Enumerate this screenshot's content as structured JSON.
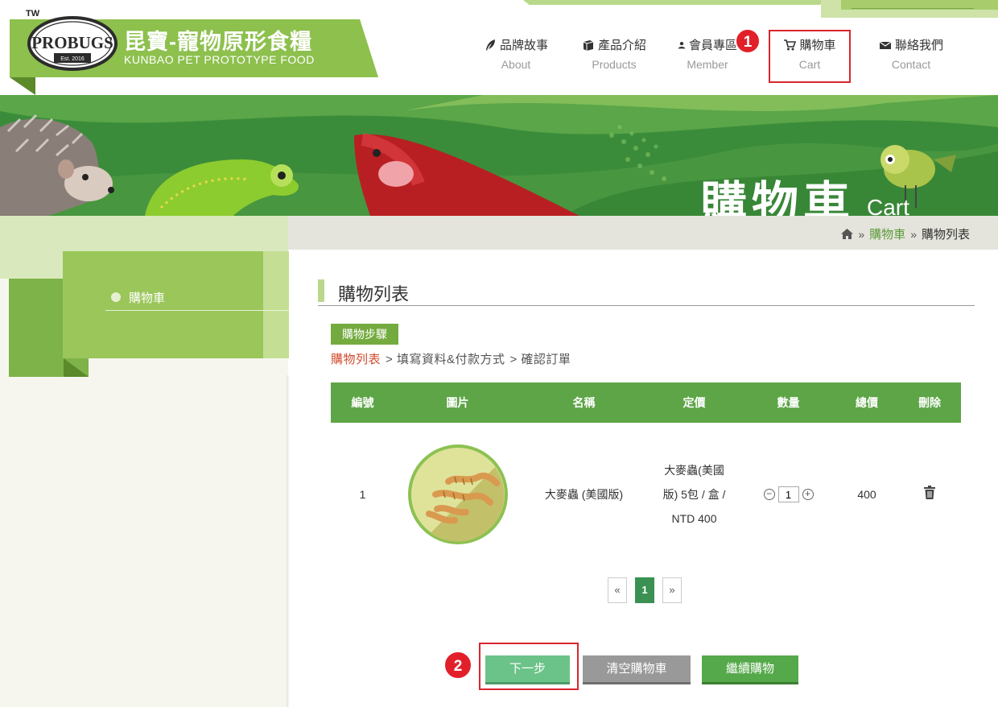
{
  "brand": {
    "tw": "TW",
    "badge_text": "PROBUGS",
    "badge_est": "Est. 2016",
    "name_zh": "昆寶-寵物原形食糧",
    "name_en": "KUNBAO PET PROTOTYPE FOOD"
  },
  "nav": [
    {
      "zh": "品牌故事",
      "en": "About",
      "icon": "feather-icon"
    },
    {
      "zh": "產品介紹",
      "en": "Products",
      "icon": "box-icon"
    },
    {
      "zh": "會員專區",
      "en": "Member",
      "icon": "user-icon"
    },
    {
      "zh": "購物車",
      "en": "Cart",
      "icon": "cart-icon"
    },
    {
      "zh": "聯絡我們",
      "en": "Contact",
      "icon": "mail-icon"
    }
  ],
  "annotations": [
    "1",
    "2"
  ],
  "banner": {
    "title_zh": "購物車",
    "title_en": "Cart"
  },
  "breadcrumb": {
    "home_icon": "home-icon",
    "cart": "購物車",
    "current": "購物列表"
  },
  "sidebar": {
    "items": [
      {
        "label": "購物車"
      }
    ]
  },
  "main": {
    "title": "購物列表",
    "steps_label": "購物步驟",
    "steps": [
      "購物列表",
      "> 填寫資料&付款方式",
      "> 確認訂單"
    ]
  },
  "table": {
    "headers": [
      "編號",
      "圖片",
      "名稱",
      "定價",
      "數量",
      "總價",
      "刪除"
    ],
    "rows": [
      {
        "no": "1",
        "name": "大麥蟲 (美國版)",
        "price": "大麥蟲(美國版) 5包 / 盒 / NTD 400",
        "qty": "1",
        "total": "400",
        "delete_icon": "trash-icon"
      }
    ]
  },
  "pagination": {
    "prev": "«",
    "current": "1",
    "next": "»"
  },
  "buttons": {
    "next": "下一步",
    "clear": "清空購物車",
    "continue": "繼續購物"
  },
  "colors": {
    "brand_green": "#8dc04d",
    "table_head": "#5da547",
    "next_btn": "#6cc389",
    "clear_btn": "#999999",
    "continue_btn": "#55a94a",
    "callout_red": "#e2202a"
  }
}
